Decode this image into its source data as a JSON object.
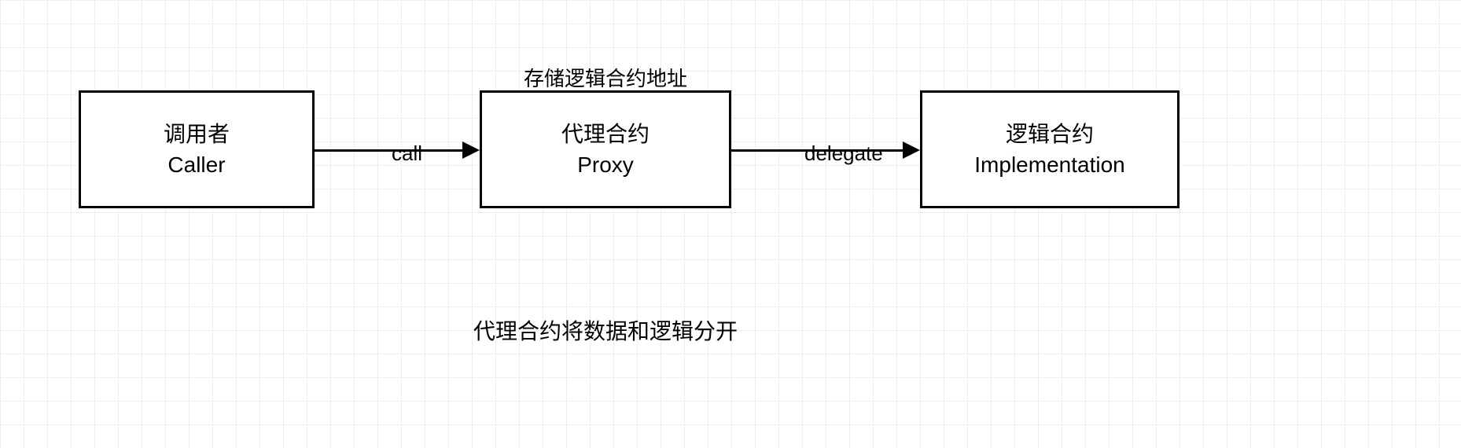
{
  "boxes": {
    "caller": {
      "line1": "调用者",
      "line2": "Caller"
    },
    "proxy": {
      "line1": "代理合约",
      "line2": "Proxy"
    },
    "implementation": {
      "line1": "逻辑合约",
      "line2": "Implementation"
    }
  },
  "annotations": {
    "proxy_top": "存储逻辑合约地址"
  },
  "arrows": {
    "call": "call",
    "delegate": "delegate"
  },
  "caption": "代理合约将数据和逻辑分开"
}
